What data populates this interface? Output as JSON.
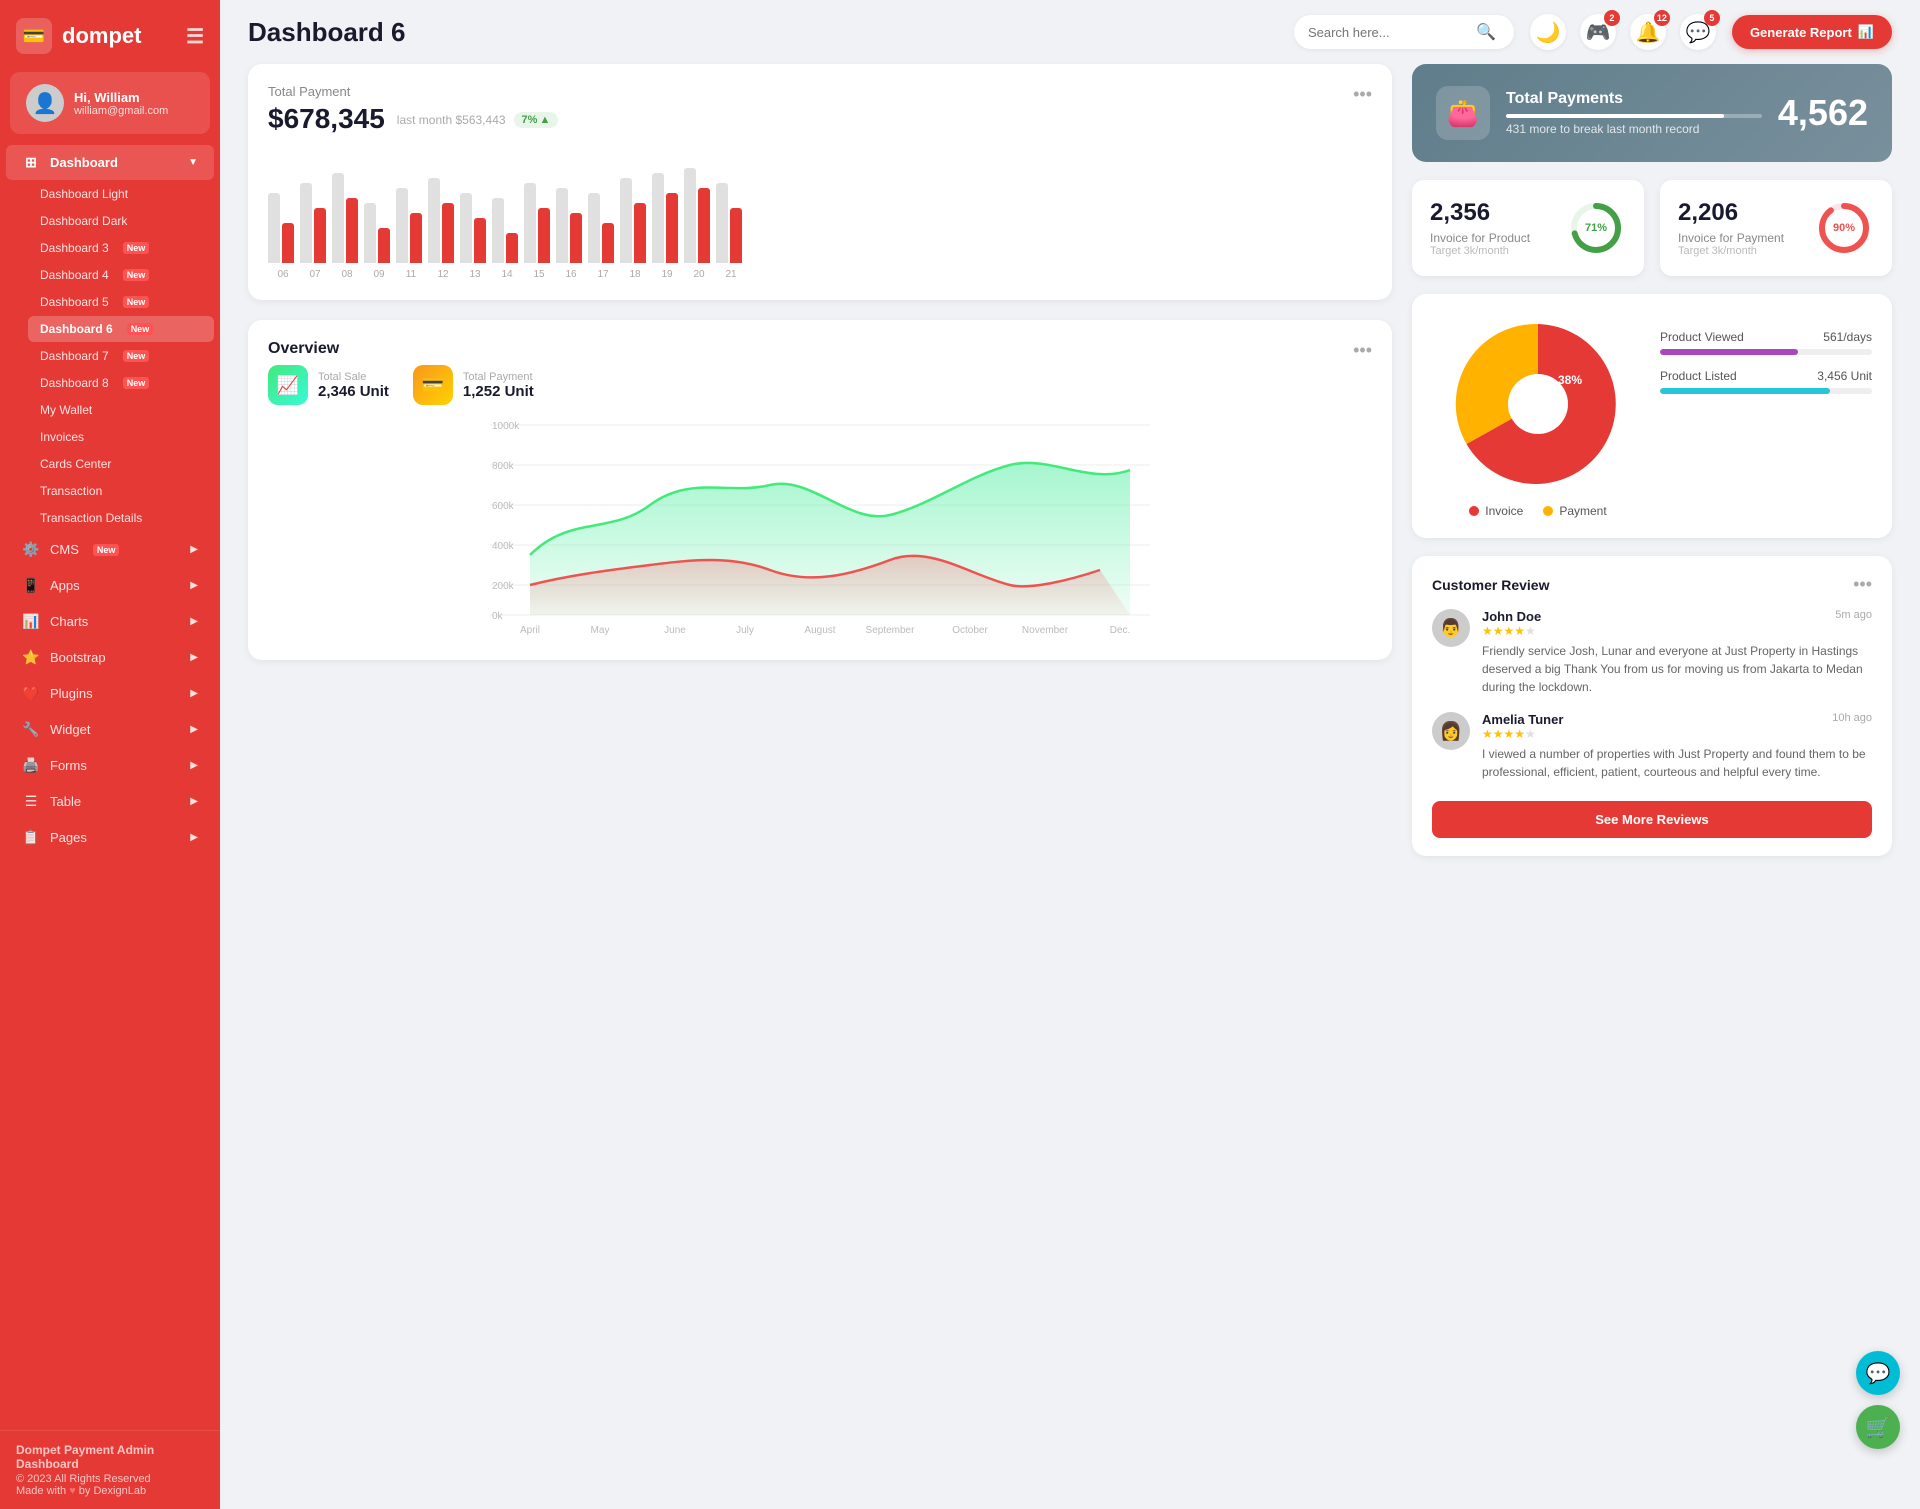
{
  "app": {
    "name": "dompet",
    "logo_icon": "💳"
  },
  "user": {
    "greeting": "Hi, William",
    "email": "william@gmail.com",
    "avatar": "👤"
  },
  "header": {
    "title": "Dashboard 6",
    "search_placeholder": "Search here...",
    "generate_btn": "Generate Report",
    "notifications": {
      "controller": "2",
      "bell": "12",
      "chat": "5"
    }
  },
  "sidebar": {
    "dashboard_label": "Dashboard",
    "items": [
      {
        "id": "dashboard-light",
        "label": "Dashboard Light",
        "badge": ""
      },
      {
        "id": "dashboard-dark",
        "label": "Dashboard Dark",
        "badge": ""
      },
      {
        "id": "dashboard-3",
        "label": "Dashboard 3",
        "badge": "New"
      },
      {
        "id": "dashboard-4",
        "label": "Dashboard 4",
        "badge": "New"
      },
      {
        "id": "dashboard-5",
        "label": "Dashboard 5",
        "badge": "New"
      },
      {
        "id": "dashboard-6",
        "label": "Dashboard 6",
        "badge": "New",
        "active": true
      },
      {
        "id": "dashboard-7",
        "label": "Dashboard 7",
        "badge": "New"
      },
      {
        "id": "dashboard-8",
        "label": "Dashboard 8",
        "badge": "New"
      },
      {
        "id": "my-wallet",
        "label": "My Wallet",
        "badge": ""
      },
      {
        "id": "invoices",
        "label": "Invoices",
        "badge": ""
      },
      {
        "id": "cards-center",
        "label": "Cards Center",
        "badge": ""
      },
      {
        "id": "transaction",
        "label": "Transaction",
        "badge": ""
      },
      {
        "id": "transaction-details",
        "label": "Transaction Details",
        "badge": ""
      }
    ],
    "menu_sections": [
      {
        "id": "cms",
        "label": "CMS",
        "badge": "New",
        "has_icon": true,
        "icon": "⚙️"
      },
      {
        "id": "apps",
        "label": "Apps",
        "has_icon": true,
        "icon": "📱"
      },
      {
        "id": "charts",
        "label": "Charts",
        "has_icon": true,
        "icon": "📊"
      },
      {
        "id": "bootstrap",
        "label": "Bootstrap",
        "has_icon": true,
        "icon": "⭐"
      },
      {
        "id": "plugins",
        "label": "Plugins",
        "has_icon": true,
        "icon": "❤️"
      },
      {
        "id": "widget",
        "label": "Widget",
        "has_icon": true,
        "icon": "🔧"
      },
      {
        "id": "forms",
        "label": "Forms",
        "has_icon": true,
        "icon": "🖨️"
      },
      {
        "id": "table",
        "label": "Table",
        "has_icon": true,
        "icon": "☰"
      },
      {
        "id": "pages",
        "label": "Pages",
        "has_icon": true,
        "icon": "📋"
      }
    ],
    "footer": {
      "brand": "Dompet Payment Admin Dashboard",
      "copyright": "© 2023 All Rights Reserved",
      "made_with": "Made with",
      "by": "by DexignLab"
    }
  },
  "total_payment": {
    "title": "Total Payment",
    "amount": "$678,345",
    "last_month_label": "last month $563,443",
    "trend_percent": "7%",
    "bars": [
      {
        "label": "06",
        "gray_h": 70,
        "red_h": 40
      },
      {
        "label": "07",
        "gray_h": 80,
        "red_h": 55
      },
      {
        "label": "08",
        "gray_h": 90,
        "red_h": 65
      },
      {
        "label": "09",
        "gray_h": 60,
        "red_h": 35
      },
      {
        "label": "11",
        "gray_h": 75,
        "red_h": 50
      },
      {
        "label": "12",
        "gray_h": 85,
        "red_h": 60
      },
      {
        "label": "13",
        "gray_h": 70,
        "red_h": 45
      },
      {
        "label": "14",
        "gray_h": 65,
        "red_h": 30
      },
      {
        "label": "15",
        "gray_h": 80,
        "red_h": 55
      },
      {
        "label": "16",
        "gray_h": 75,
        "red_h": 50
      },
      {
        "label": "17",
        "gray_h": 70,
        "red_h": 40
      },
      {
        "label": "18",
        "gray_h": 85,
        "red_h": 60
      },
      {
        "label": "19",
        "gray_h": 90,
        "red_h": 70
      },
      {
        "label": "20",
        "gray_h": 95,
        "red_h": 75
      },
      {
        "label": "21",
        "gray_h": 80,
        "red_h": 55
      }
    ]
  },
  "total_payments_card": {
    "title": "Total Payments",
    "sub": "431 more to break last month record",
    "number": "4,562",
    "icon": "👛",
    "progress": 85
  },
  "invoice_product": {
    "value": "2,356",
    "label": "Invoice for Product",
    "target": "Target 3k/month",
    "percent": 71,
    "color": "#43a047"
  },
  "invoice_payment": {
    "value": "2,206",
    "label": "Invoice for Payment",
    "target": "Target 3k/month",
    "percent": 90,
    "color": "#ef5350"
  },
  "overview": {
    "title": "Overview",
    "total_sale_label": "Total Sale",
    "total_sale_value": "2,346 Unit",
    "total_payment_label": "Total Payment",
    "total_payment_value": "1,252 Unit",
    "months": [
      "April",
      "May",
      "June",
      "July",
      "August",
      "September",
      "October",
      "November",
      "Dec."
    ],
    "y_labels": [
      "1000k",
      "800k",
      "600k",
      "400k",
      "200k",
      "0k"
    ]
  },
  "pie_chart": {
    "invoice_pct": 62,
    "payment_pct": 38,
    "invoice_label": "Invoice",
    "payment_label": "Payment",
    "invoice_color": "#e53935",
    "payment_color": "#ffb300"
  },
  "product_stats": {
    "viewed": {
      "label": "Product Viewed",
      "value": "561/days",
      "color": "#ab47bc",
      "pct": 65
    },
    "listed": {
      "label": "Product Listed",
      "value": "3,456 Unit",
      "color": "#26c6da",
      "pct": 80
    }
  },
  "reviews": {
    "title": "Customer Review",
    "btn_label": "See More Reviews",
    "items": [
      {
        "name": "John Doe",
        "time": "5m ago",
        "stars": 4,
        "text": "Friendly service Josh, Lunar and everyone at Just Property in Hastings deserved a big Thank You from us for moving us from Jakarta to Medan during the lockdown.",
        "avatar": "👨"
      },
      {
        "name": "Amelia Tuner",
        "time": "10h ago",
        "stars": 4,
        "text": "I viewed a number of properties with Just Property and found them to be professional, efficient, patient, courteous and helpful every time.",
        "avatar": "👩"
      }
    ]
  }
}
